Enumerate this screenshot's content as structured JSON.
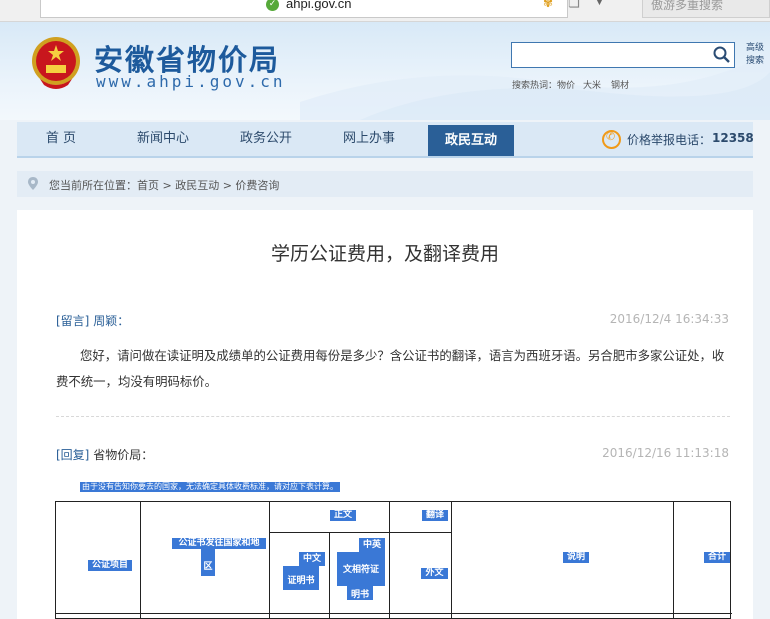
{
  "browser": {
    "url": "ahpi.gov.cn",
    "search_engine_placeholder": "傲游多重搜索"
  },
  "header": {
    "title": "安徽省物价局",
    "url": "www.ahpi.gov.cn",
    "search_placeholder": "",
    "advanced_search": "高级搜索",
    "hot_label": "搜索热词：",
    "hot_terms": [
      "物价",
      "大米",
      "钢材"
    ]
  },
  "nav": {
    "items": [
      "首 页",
      "新闻中心",
      "政务公开",
      "网上办事",
      "政民互动"
    ],
    "active_index": 4,
    "phone_label": "价格举报电话：",
    "phone_number": "12358"
  },
  "breadcrumb": {
    "text": "您当前所在位置：首页 > 政民互动 > 价费咨询"
  },
  "article": {
    "title": "学历公证费用，及翻译费用",
    "question": {
      "tag": "[留言]",
      "author": "周颖：",
      "time": "2016/12/4 16:34:33",
      "body": "您好，请问做在读证明及成绩单的公证费用每份是多少？含公证书的翻译，语言为西班牙语。另合肥市多家公证处，收费不统一，均没有明码标价。"
    },
    "reply": {
      "tag": "[回复]",
      "author": "省物价局：",
      "time": "2016/12/16 11:13:18",
      "intro": "由于没有告知你要去的国家，无法确定具体收费标准，请对应下表计算。"
    }
  },
  "table": {
    "headers": {
      "item": "公证项目",
      "country": "公证书发往国家和地区",
      "country_part1": "公证书发往国家和地",
      "country_part2": "区",
      "translation": "正文",
      "translation_cn": "中文证明书",
      "translation_cn_part1": "中文",
      "translation_cn_part2": "证明书",
      "translation_en": "中英文相符证明书",
      "translation_en_part1": "中英",
      "translation_en_part2": "文相符证",
      "translation_en_part3": "明书",
      "translation_fee": "翻译",
      "foreign": "外文",
      "note": "说明",
      "total": "合计"
    }
  }
}
